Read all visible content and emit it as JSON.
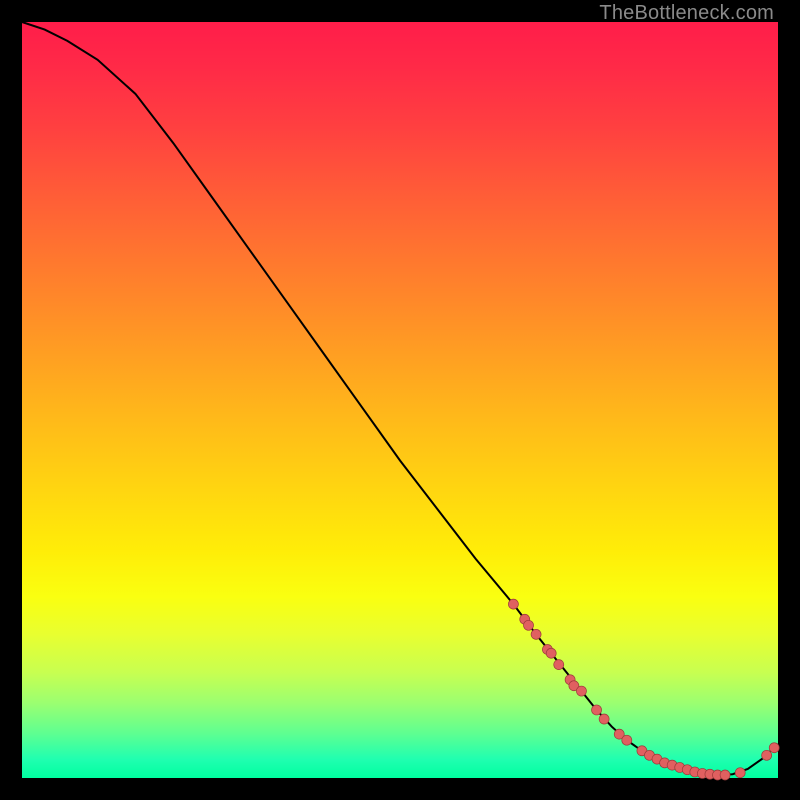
{
  "watermark": "TheBottleneck.com",
  "colors": {
    "background": "#000000",
    "line": "#000000",
    "dot_fill": "#e06060",
    "dot_stroke": "#9c3a3a"
  },
  "chart_data": {
    "type": "line",
    "title": "",
    "xlabel": "",
    "ylabel": "",
    "xlim": [
      0,
      100
    ],
    "ylim": [
      0,
      100
    ],
    "series": [
      {
        "name": "curve",
        "x": [
          0,
          3,
          6,
          10,
          15,
          20,
          25,
          30,
          35,
          40,
          45,
          50,
          55,
          60,
          65,
          68,
          70,
          72,
          74,
          76,
          78,
          80,
          82,
          84,
          86,
          88,
          90,
          92,
          94,
          96,
          98,
          100
        ],
        "y": [
          100,
          99,
          97.5,
          95,
          90.5,
          84,
          77,
          70,
          63,
          56,
          49,
          42,
          35.5,
          29,
          23,
          19,
          16.5,
          14,
          11.5,
          9,
          6.8,
          5,
          3.6,
          2.5,
          1.7,
          1.1,
          0.6,
          0.4,
          0.5,
          1.2,
          2.6,
          4.5
        ]
      }
    ],
    "scatter": [
      {
        "name": "dots",
        "points": [
          [
            65,
            23
          ],
          [
            66.5,
            21
          ],
          [
            67,
            20.2
          ],
          [
            68,
            19
          ],
          [
            69.5,
            17
          ],
          [
            70,
            16.5
          ],
          [
            71,
            15
          ],
          [
            72.5,
            13
          ],
          [
            73,
            12.2
          ],
          [
            74,
            11.5
          ],
          [
            76,
            9
          ],
          [
            77,
            7.8
          ],
          [
            79,
            5.8
          ],
          [
            80,
            5
          ],
          [
            82,
            3.6
          ],
          [
            83,
            3
          ],
          [
            84,
            2.5
          ],
          [
            85,
            2
          ],
          [
            86,
            1.7
          ],
          [
            87,
            1.4
          ],
          [
            88,
            1.1
          ],
          [
            89,
            0.8
          ],
          [
            90,
            0.6
          ],
          [
            91,
            0.5
          ],
          [
            92,
            0.4
          ],
          [
            93,
            0.4
          ],
          [
            95,
            0.7
          ],
          [
            98.5,
            3
          ],
          [
            99.5,
            4
          ]
        ]
      }
    ]
  }
}
